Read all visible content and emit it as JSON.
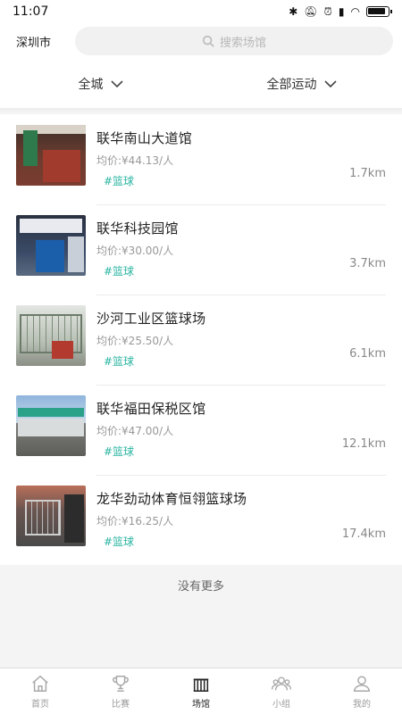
{
  "status_bar": {
    "time": "11:07",
    "icons": [
      "bluetooth-icon",
      "mute-icon",
      "alarm-icon",
      "hd-signal-icon",
      "wifi-icon",
      "battery-icon"
    ]
  },
  "header": {
    "city": "深圳市",
    "search_placeholder": "搜索场馆"
  },
  "filters": {
    "area": "全城",
    "sport": "全部运动"
  },
  "venues": [
    {
      "name": "联华南山大道馆",
      "price": "均价:¥44.13/人",
      "tag": "#篮球",
      "distance": "1.7km"
    },
    {
      "name": "联华科技园馆",
      "price": "均价:¥30.00/人",
      "tag": "#篮球",
      "distance": "3.7km"
    },
    {
      "name": "沙河工业区篮球场",
      "price": "均价:¥25.50/人",
      "tag": "#篮球",
      "distance": "6.1km"
    },
    {
      "name": "联华福田保税区馆",
      "price": "均价:¥47.00/人",
      "tag": "#篮球",
      "distance": "12.1km"
    },
    {
      "name": "龙华劲动体育恒翎篮球场",
      "price": "均价:¥16.25/人",
      "tag": "#篮球",
      "distance": "17.4km"
    }
  ],
  "no_more": "没有更多",
  "tabbar": {
    "items": [
      {
        "label": "首页",
        "icon": "home-icon"
      },
      {
        "label": "比赛",
        "icon": "trophy-icon"
      },
      {
        "label": "场馆",
        "icon": "venue-icon"
      },
      {
        "label": "小组",
        "icon": "group-icon"
      },
      {
        "label": "我的",
        "icon": "profile-icon"
      }
    ],
    "active": "场馆"
  },
  "colors": {
    "tag": "#2bb5a2",
    "background": "#f4f4f4",
    "active_tab": "#222222",
    "inactive_tab": "#9a9a9a"
  }
}
